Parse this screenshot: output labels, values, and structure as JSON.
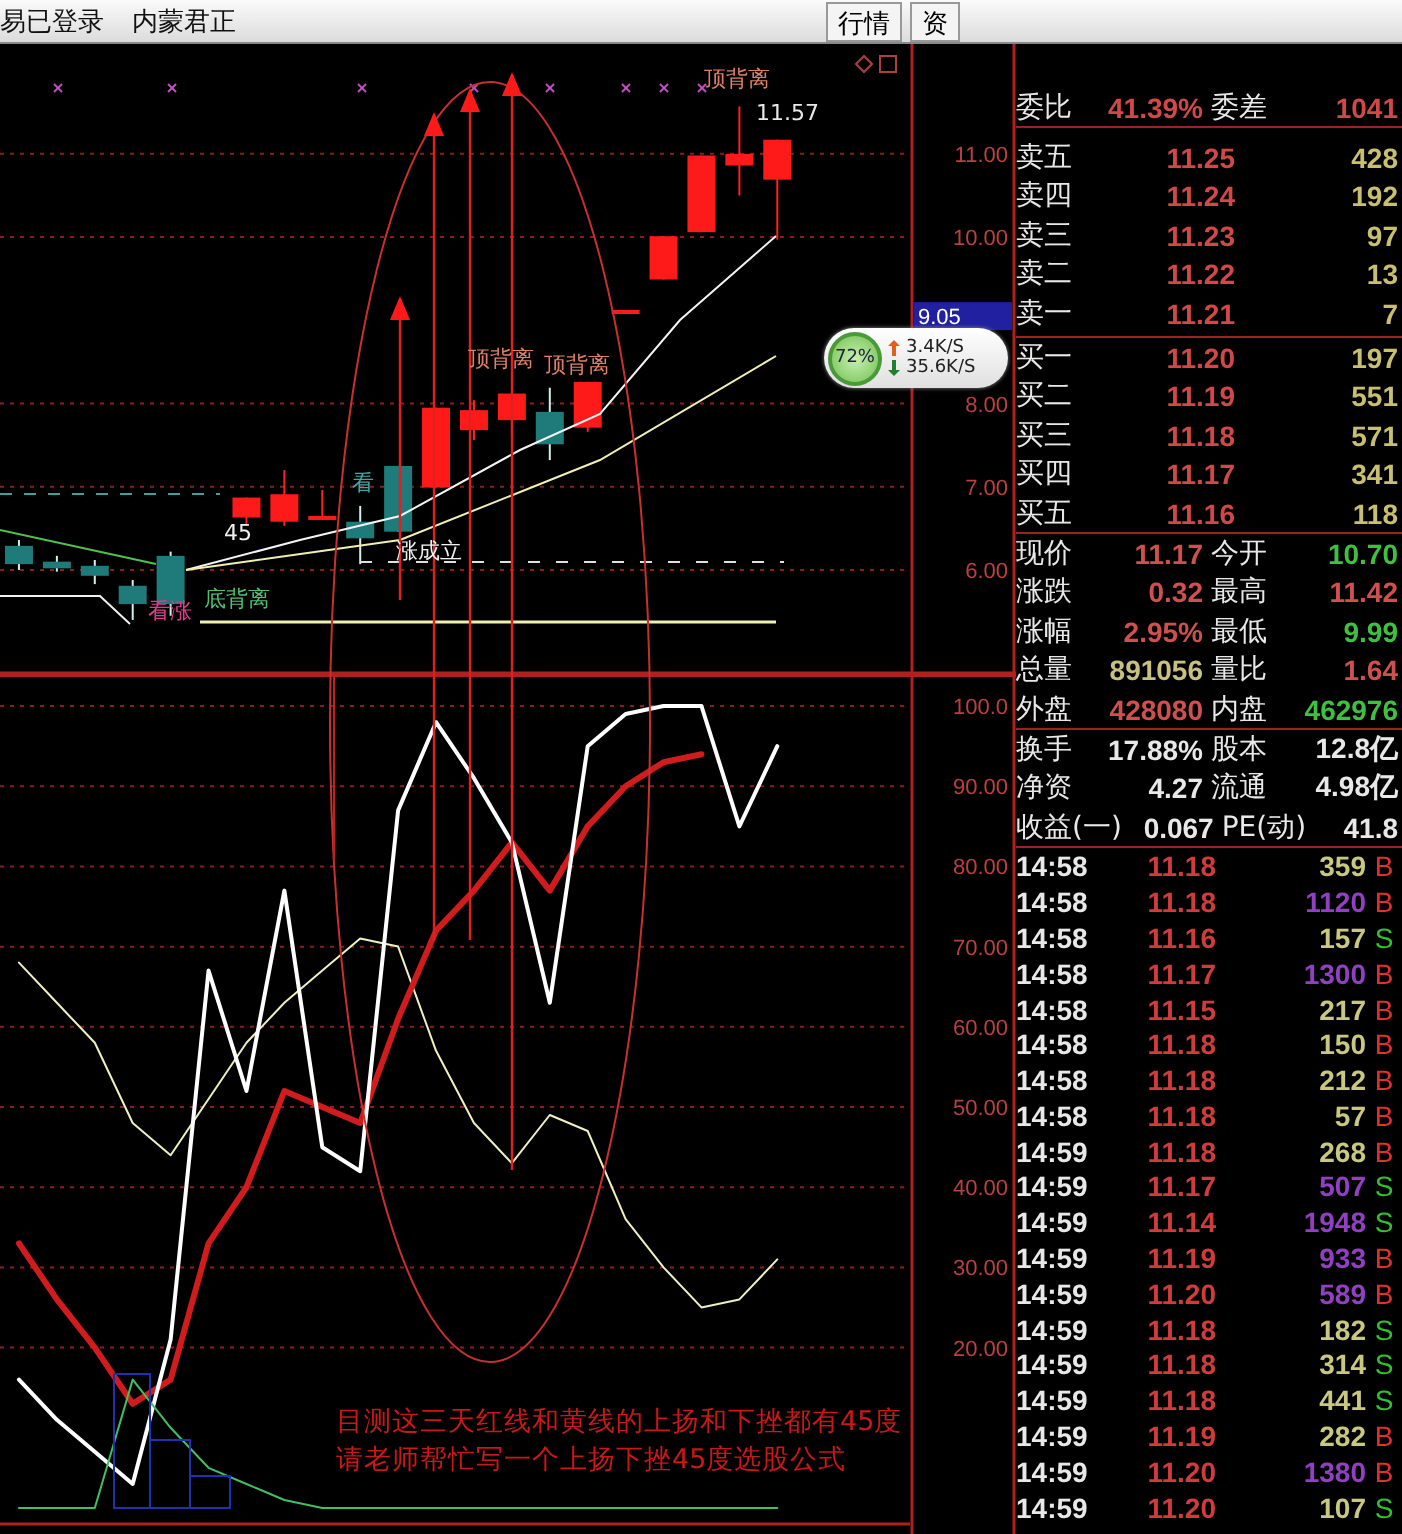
{
  "header": {
    "status": "易已登录",
    "stock_name": "内蒙君正",
    "buttons": [
      {
        "label": "行情"
      },
      {
        "label": "资"
      }
    ]
  },
  "kline": {
    "annotations": [
      {
        "text": "顶背离",
        "color": "#e08068"
      },
      {
        "text": "11.57",
        "color": "#e8e8e8"
      },
      {
        "text": "顶背离",
        "color": "#e08068"
      },
      {
        "text": "顶背离",
        "color": "#e08068"
      },
      {
        "text": "看",
        "color": "#40a8a8"
      },
      {
        "text": "45",
        "color": "#f0f0f0"
      },
      {
        "text": "涨成立",
        "color": "#f0f0f0"
      },
      {
        "text": "看涨",
        "color": "#e03c8c"
      },
      {
        "text": "底背离",
        "color": "#50c070"
      }
    ],
    "price_marker": "9.05",
    "chart_data": {
      "type": "candlestick",
      "categories": [
        null,
        null,
        null,
        null,
        null,
        null,
        null,
        null,
        null,
        null,
        null,
        null,
        null,
        null,
        null,
        null,
        null,
        null,
        null,
        null,
        null,
        null,
        null,
        null
      ],
      "ylim": [
        4.75,
        12.32
      ],
      "grid": true,
      "yticks": [
        {
          "value": 11,
          "label": "11.00"
        },
        {
          "value": 10,
          "label": "10.00"
        },
        {
          "value": 8,
          "label": "8.00"
        },
        {
          "value": 7,
          "label": "7.00"
        },
        {
          "value": 6,
          "label": "6.00"
        }
      ],
      "ohlc": [
        [
          6.29,
          6.36,
          6.0,
          6.07
        ],
        [
          6.1,
          6.17,
          5.98,
          6.02
        ],
        [
          6.05,
          6.12,
          5.83,
          5.93
        ],
        [
          5.81,
          5.88,
          5.4,
          5.59
        ],
        [
          6.17,
          6.22,
          5.45,
          5.59
        ],
        null,
        [
          6.63,
          6.87,
          6.53,
          6.87
        ],
        [
          6.58,
          7.2,
          6.53,
          6.91
        ],
        [
          6.62,
          6.96,
          6.6,
          6.63
        ],
        [
          6.58,
          6.77,
          6.07,
          6.38
        ],
        [
          7.25,
          7.25,
          6.46,
          6.46
        ],
        [
          6.99,
          7.95,
          6.99,
          7.95
        ],
        [
          7.68,
          8.04,
          7.56,
          7.92
        ],
        [
          7.8,
          8.12,
          7.61,
          8.12
        ],
        [
          7.9,
          8.19,
          7.32,
          7.51
        ],
        [
          7.71,
          8.26,
          7.66,
          8.26
        ],
        [
          9.1,
          9.1,
          9.1,
          9.1
        ],
        [
          9.49,
          10.01,
          9.49,
          10.01
        ],
        [
          10.06,
          10.98,
          10.06,
          10.98
        ],
        [
          10.86,
          11.57,
          10.5,
          11.0
        ],
        [
          10.69,
          11.17,
          9.97,
          11.17
        ],
        null,
        null,
        null
      ]
    }
  },
  "indicator": {
    "chart_data": {
      "type": "line",
      "categories": [
        null,
        null,
        null,
        null,
        null,
        null,
        null,
        null,
        null,
        null,
        null,
        null,
        null,
        null,
        null,
        null,
        null,
        null,
        null,
        null,
        null,
        null,
        null,
        null
      ],
      "ylim": [
        -2,
        104
      ],
      "grid": true,
      "yticks": [
        {
          "value": 100,
          "label": "100.0"
        },
        {
          "value": 90,
          "label": "90.00"
        },
        {
          "value": 80,
          "label": "80.00"
        },
        {
          "value": 70,
          "label": "70.00"
        },
        {
          "value": 60,
          "label": "60.00"
        },
        {
          "value": 50,
          "label": "50.00"
        },
        {
          "value": 40,
          "label": "40.00"
        },
        {
          "value": 30,
          "label": "30.00"
        },
        {
          "value": 20,
          "label": "20.00"
        }
      ],
      "series": [
        {
          "color": "#f0f0c0",
          "values": [
            68,
            63,
            58,
            48,
            44,
            51,
            58,
            63,
            67,
            71,
            70,
            57,
            48,
            43,
            49,
            47,
            36,
            30,
            25,
            26,
            31,
            null,
            null,
            null
          ]
        },
        {
          "color": "#d01c1c",
          "values": [
            33,
            26,
            20,
            13,
            16,
            33,
            40,
            52,
            50,
            48,
            61,
            72,
            77,
            83,
            77,
            85,
            90,
            93,
            94,
            null,
            null,
            null,
            null,
            null
          ]
        },
        {
          "color": "#ffffff",
          "values": [
            16,
            11,
            7,
            3,
            21,
            67,
            52,
            77,
            45,
            42,
            87,
            98,
            91,
            83,
            63,
            95,
            99,
            100,
            100,
            85,
            95,
            null,
            null,
            null
          ]
        },
        {
          "color": "#40c060",
          "values": [
            0,
            0,
            0,
            16,
            10,
            5,
            3,
            1,
            0,
            0,
            0,
            0,
            0,
            0,
            0,
            0,
            0,
            0,
            0,
            0,
            0,
            null,
            null,
            null
          ]
        }
      ]
    },
    "notes": [
      "目测这三天红线和黄线的上扬和下挫都有45度",
      "请老师帮忙写一个上扬下挫45度选股公式"
    ]
  },
  "network_widget": {
    "percent": "72%",
    "upload": "3.4K/S",
    "download": "35.6K/S"
  },
  "quote": {
    "ratio": {
      "label": "委比",
      "value": "41.39%",
      "label2": "委差",
      "value2": "1041"
    },
    "asks": [
      {
        "label": "卖五",
        "price": "11.25",
        "volume": "428"
      },
      {
        "label": "卖四",
        "price": "11.24",
        "volume": "192"
      },
      {
        "label": "卖三",
        "price": "11.23",
        "volume": "97"
      },
      {
        "label": "卖二",
        "price": "11.22",
        "volume": "13"
      },
      {
        "label": "卖一",
        "price": "11.21",
        "volume": "7"
      }
    ],
    "bids": [
      {
        "label": "买一",
        "price": "11.20",
        "volume": "197"
      },
      {
        "label": "买二",
        "price": "11.19",
        "volume": "551"
      },
      {
        "label": "买三",
        "price": "11.18",
        "volume": "571"
      },
      {
        "label": "买四",
        "price": "11.17",
        "volume": "341"
      },
      {
        "label": "买五",
        "price": "11.16",
        "volume": "118"
      }
    ],
    "stats": [
      {
        "left": {
          "label": "现价",
          "value": "11.17",
          "color": "#d05050"
        },
        "right": {
          "label": "今开",
          "value": "10.70",
          "color": "#40c040"
        }
      },
      {
        "left": {
          "label": "涨跌",
          "value": "0.32",
          "color": "#d05050"
        },
        "right": {
          "label": "最高",
          "value": "11.42",
          "color": "#d05050"
        }
      },
      {
        "left": {
          "label": "涨幅",
          "value": "2.95%",
          "color": "#d05050"
        },
        "right": {
          "label": "最低",
          "value": "9.99",
          "color": "#40c040"
        }
      },
      {
        "left": {
          "label": "总量",
          "value": "891056",
          "color": "#c8c080"
        },
        "right": {
          "label": "量比",
          "value": "1.64",
          "color": "#d05050"
        }
      },
      {
        "left": {
          "label": "外盘",
          "value": "428080",
          "color": "#d05050"
        },
        "right": {
          "label": "内盘",
          "value": "462976",
          "color": "#40c040"
        }
      }
    ],
    "extra": [
      {
        "label": "换手",
        "value": "17.88%",
        "label2": "股本",
        "value2": "12.8亿"
      },
      {
        "label": "净资",
        "value": "4.27",
        "label2": "流通",
        "value2": "4.98亿"
      },
      {
        "label": "收益(一)",
        "value": "0.067",
        "label2": "PE(动)",
        "value2": "41.8"
      }
    ],
    "ticks": [
      {
        "time": "14:58",
        "price": "11.18",
        "volume": "359",
        "large": false,
        "side": "B",
        "kind": "buy"
      },
      {
        "time": "14:58",
        "price": "11.18",
        "volume": "1120",
        "large": true,
        "side": "B",
        "kind": "buy"
      },
      {
        "time": "14:58",
        "price": "11.16",
        "volume": "157",
        "large": false,
        "side": "S",
        "kind": "sell"
      },
      {
        "time": "14:58",
        "price": "11.17",
        "volume": "1300",
        "large": true,
        "side": "B",
        "kind": "buy"
      },
      {
        "time": "14:58",
        "price": "11.15",
        "volume": "217",
        "large": false,
        "side": "B",
        "kind": "buy"
      },
      {
        "time": "14:58",
        "price": "11.18",
        "volume": "150",
        "large": false,
        "side": "B",
        "kind": "buy"
      },
      {
        "time": "14:58",
        "price": "11.18",
        "volume": "212",
        "large": false,
        "side": "B",
        "kind": "buy"
      },
      {
        "time": "14:58",
        "price": "11.18",
        "volume": "57",
        "large": false,
        "side": "B",
        "kind": "buy"
      },
      {
        "time": "14:59",
        "price": "11.18",
        "volume": "268",
        "large": false,
        "side": "B",
        "kind": "buy"
      },
      {
        "time": "14:59",
        "price": "11.17",
        "volume": "507",
        "large": true,
        "side": "S",
        "kind": "sell"
      },
      {
        "time": "14:59",
        "price": "11.14",
        "volume": "1948",
        "large": true,
        "side": "S",
        "kind": "sell"
      },
      {
        "time": "14:59",
        "price": "11.19",
        "volume": "933",
        "large": true,
        "side": "B",
        "kind": "buy"
      },
      {
        "time": "14:59",
        "price": "11.20",
        "volume": "589",
        "large": true,
        "side": "B",
        "kind": "buy"
      },
      {
        "time": "14:59",
        "price": "11.18",
        "volume": "182",
        "large": false,
        "side": "S",
        "kind": "sell"
      },
      {
        "time": "14:59",
        "price": "11.18",
        "volume": "314",
        "large": false,
        "side": "S",
        "kind": "sell"
      },
      {
        "time": "14:59",
        "price": "11.18",
        "volume": "441",
        "large": false,
        "side": "S",
        "kind": "sell"
      },
      {
        "time": "14:59",
        "price": "11.19",
        "volume": "282",
        "large": false,
        "side": "B",
        "kind": "buy"
      },
      {
        "time": "14:59",
        "price": "11.20",
        "volume": "1380",
        "large": true,
        "side": "B",
        "kind": "buy"
      },
      {
        "time": "14:59",
        "price": "11.20",
        "volume": "107",
        "large": false,
        "side": "S",
        "kind": "sell"
      }
    ]
  }
}
